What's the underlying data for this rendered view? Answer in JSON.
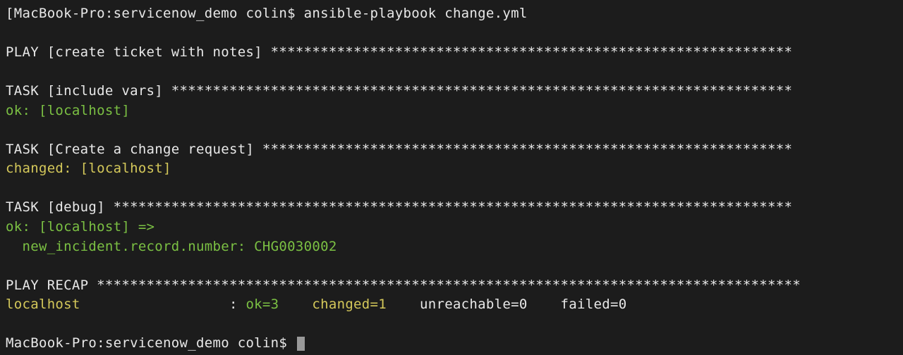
{
  "prompt1": {
    "bracket": "[",
    "host": "MacBook-Pro:",
    "dir": "servicenow_demo ",
    "user": "colin$ ",
    "cmd": "ansible-playbook change.yml"
  },
  "play_header": {
    "label": "PLAY [create ticket with notes] ",
    "stars": "***************************************************************"
  },
  "task1": {
    "label": "TASK [include vars] ",
    "stars": "***************************************************************************",
    "result": "ok: [localhost]"
  },
  "task2": {
    "label": "TASK [Create a change request] ",
    "stars": "****************************************************************",
    "result": "changed: [localhost]"
  },
  "task3": {
    "label": "TASK [debug] ",
    "stars": "**********************************************************************************",
    "result_line1": "ok: [localhost] =>",
    "result_line2": "  new_incident.record.number: CHG0030002"
  },
  "recap": {
    "label": "PLAY RECAP ",
    "stars": "*************************************************************************************",
    "host": "localhost                  ",
    "colon": ": ",
    "ok": "ok=3   ",
    "changed": " changed=1   ",
    "unreachable": " unreachable=0   ",
    "failed": " failed=0"
  },
  "prompt2": {
    "host": "MacBook-Pro:",
    "dir": "servicenow_demo ",
    "user": "colin$ "
  }
}
